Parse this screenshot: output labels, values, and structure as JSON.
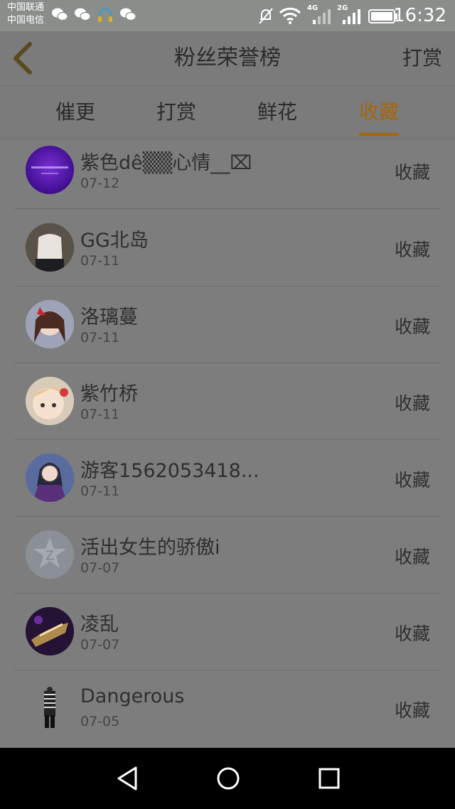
{
  "status_bar": {
    "carrier_1": "中国联通",
    "carrier_2": "中国电信",
    "net_1": "4G",
    "net_2": "2G",
    "time": "16:32",
    "icons": [
      "wechat-icon",
      "wechat-icon",
      "headset-icon",
      "wechat-icon",
      "mute-icon",
      "wifi-icon",
      "signal-icon",
      "signal-icon",
      "battery-icon"
    ]
  },
  "header": {
    "title": "粉丝荣誉榜",
    "action_label": "打赏",
    "back_icon": "back-arrow-icon"
  },
  "tabs": [
    {
      "label": "催更",
      "active": false
    },
    {
      "label": "打赏",
      "active": false
    },
    {
      "label": "鲜花",
      "active": false
    },
    {
      "label": "收藏",
      "active": true
    }
  ],
  "list": [
    {
      "name": "紫色dê▒▒心情__⌧",
      "date": "07-12",
      "action": "收藏"
    },
    {
      "name": "GG北岛",
      "date": "07-11",
      "action": "收藏"
    },
    {
      "name": "洛璃蔓",
      "date": "07-11",
      "action": "收藏"
    },
    {
      "name": "紫竹桥",
      "date": "07-11",
      "action": "收藏"
    },
    {
      "name": "游客1562053418...",
      "date": "07-11",
      "action": "收藏"
    },
    {
      "name": "活出女生的骄傲i",
      "date": "07-07",
      "action": "收藏"
    },
    {
      "name": "凌乱",
      "date": "07-07",
      "action": "收藏"
    },
    {
      "name": "Dangerous",
      "date": "07-05",
      "action": "收藏"
    }
  ],
  "nav_bar": {
    "back": "nav-back-icon",
    "home": "nav-home-icon",
    "recents": "nav-recents-icon"
  },
  "colors": {
    "accent": "#a7650c",
    "overlay_bg": "#7d7d7d"
  }
}
